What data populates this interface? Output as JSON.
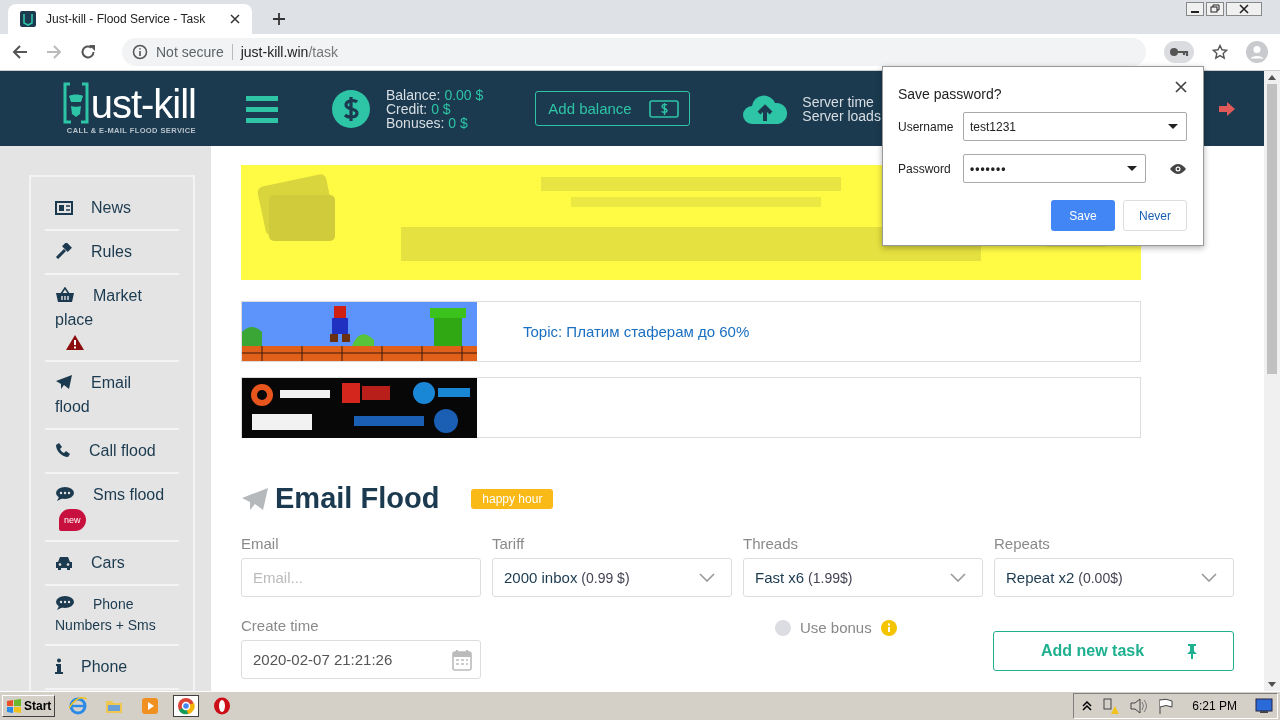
{
  "browser": {
    "tabs": [
      {
        "title": "Just-kill - Flood Service - Task",
        "selected": true
      }
    ],
    "address": {
      "security": "Not secure",
      "host": "just-kill.win",
      "path": "/task"
    }
  },
  "header": {
    "logo": {
      "name": "ust-kill",
      "tagline": "CALL & E-MAIL FLOOD SERVICE"
    },
    "balance": [
      {
        "label": "Balance:",
        "value": "0.00 $"
      },
      {
        "label": "Credit:",
        "value": "0 $"
      },
      {
        "label": "Bonuses:",
        "value": "0 $"
      }
    ],
    "add_balance": "Add balance",
    "server": [
      "Server time",
      "Server loads"
    ]
  },
  "sidebar": {
    "items": [
      {
        "label": "News",
        "kind": "plain"
      },
      {
        "label": "Rules",
        "kind": "plain"
      },
      {
        "label": "Market place",
        "kind": "warning"
      },
      {
        "label": "Email flood",
        "kind": "plain"
      },
      {
        "label": "Call flood",
        "kind": "plain"
      },
      {
        "label": "Sms flood",
        "kind": "badge",
        "badge": "new"
      },
      {
        "label": "Cars",
        "kind": "plain"
      },
      {
        "label": "Phone Numbers + Sms",
        "kind": "small"
      },
      {
        "label": "Phone",
        "kind": "plain"
      }
    ]
  },
  "ads": {
    "top_banner": {
      "kind": "picture"
    },
    "rows": [
      {
        "kind": "picture",
        "link": "Topic: Платим стаферам до 60%"
      },
      {
        "kind": "picture"
      }
    ]
  },
  "form": {
    "title": "Email Flood",
    "badge": "happy hour",
    "fields": [
      {
        "label": "Email",
        "kind": "input",
        "placeholder": "Email..."
      },
      {
        "label": "Tariff",
        "kind": "select",
        "value": "**2000 inbox** (0.99 $)"
      },
      {
        "label": "Threads",
        "kind": "select",
        "value": "**Fast x6** (1.99$)"
      },
      {
        "label": "Repeats",
        "kind": "select",
        "value": "**Repeat x2** (0.00$)"
      }
    ],
    "create_time": {
      "label": "Create time",
      "value": "2020-02-07 21:21:26"
    },
    "use_bonus": {
      "label": "Use bonus",
      "checked": false
    },
    "submit": "Add new task"
  },
  "popup": {
    "title": "Save password?",
    "username": {
      "label": "Username",
      "value": "test1231"
    },
    "password": {
      "label": "Password",
      "value": "•••••••"
    },
    "buttons": [
      {
        "label": "Save",
        "kind": "primary"
      },
      {
        "label": "Never",
        "kind": "secondary"
      }
    ]
  },
  "taskbar": {
    "start": "Start",
    "apps": [
      {
        "selected": false
      },
      {
        "selected": false
      },
      {
        "selected": false
      },
      {
        "selected": true
      },
      {
        "selected": false
      }
    ],
    "clock": "6:21 PM"
  }
}
